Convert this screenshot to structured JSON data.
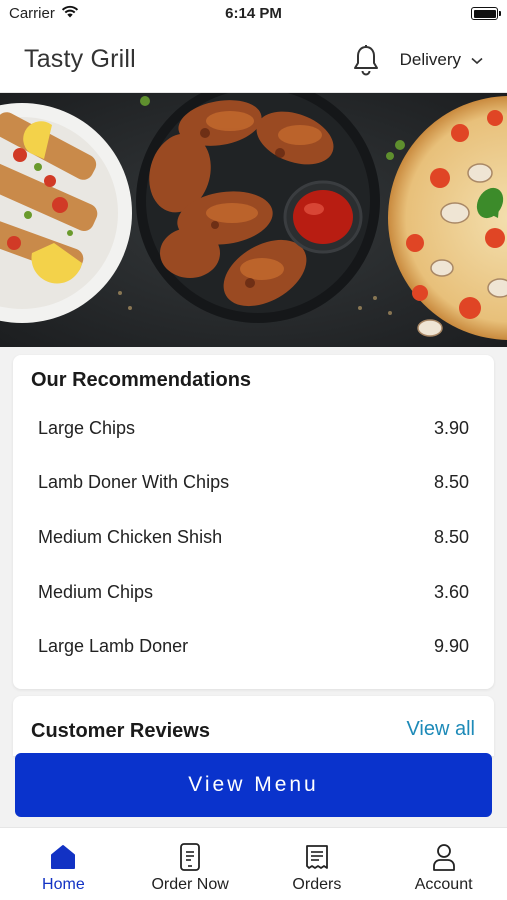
{
  "status": {
    "carrier": "Carrier",
    "time": "6:14 PM"
  },
  "header": {
    "title": "Tasty Grill",
    "delivery_label": "Delivery"
  },
  "recommendations": {
    "title": "Our Recommendations",
    "items": [
      {
        "name": "Large Chips",
        "price": "3.90"
      },
      {
        "name": "Lamb Doner With Chips",
        "price": "8.50"
      },
      {
        "name": "Medium Chicken Shish",
        "price": "8.50"
      },
      {
        "name": "Medium Chips",
        "price": "3.60"
      },
      {
        "name": "Large Lamb Doner",
        "price": "9.90"
      }
    ]
  },
  "reviews": {
    "title": "Customer Reviews",
    "view_all": "View all"
  },
  "view_menu_label": "View Menu",
  "tabs": [
    {
      "label": "Home",
      "icon": "home-icon",
      "active": true
    },
    {
      "label": "Order Now",
      "icon": "phone-order-icon",
      "active": false
    },
    {
      "label": "Orders",
      "icon": "receipt-icon",
      "active": false
    },
    {
      "label": "Account",
      "icon": "person-icon",
      "active": false
    }
  ],
  "colors": {
    "primary": "#0a33cc",
    "link": "#1d8ab8",
    "active_tab": "#1232c4"
  }
}
